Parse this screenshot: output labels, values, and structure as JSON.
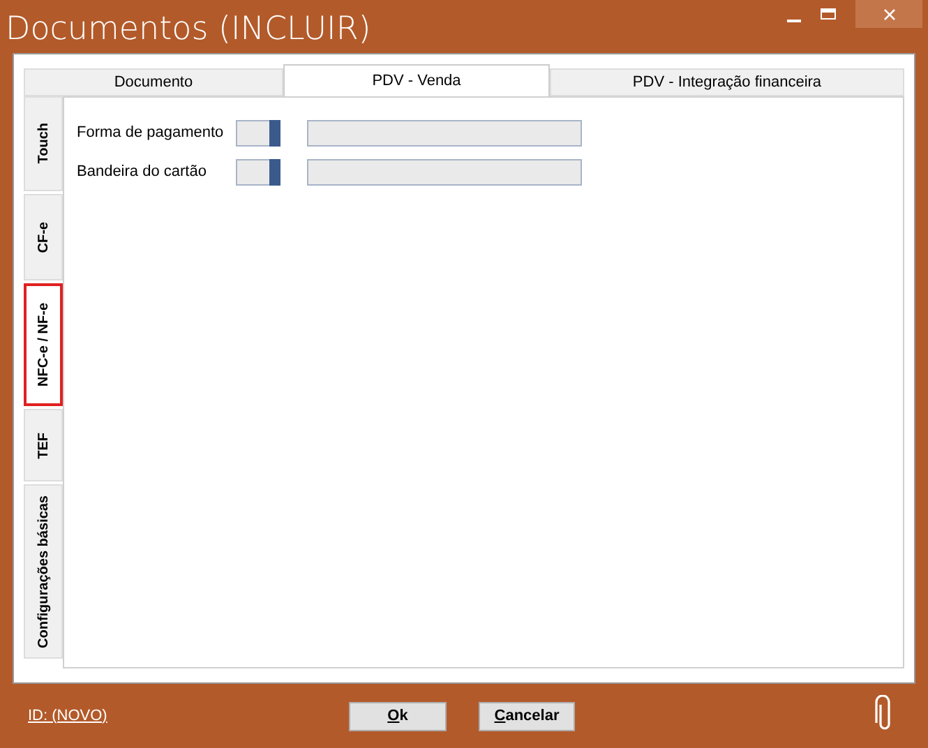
{
  "window": {
    "title": "Documentos (INCLUIR)"
  },
  "tabs": [
    {
      "label": "Documento",
      "selected": false
    },
    {
      "label": "PDV - Venda",
      "selected": true
    },
    {
      "label": "PDV - Integração financeira",
      "selected": false
    }
  ],
  "side_tabs": [
    {
      "label": "Touch",
      "selected": false
    },
    {
      "label": "CF-e",
      "selected": false
    },
    {
      "label": "NFC-e / NF-e",
      "selected": true
    },
    {
      "label": "TEF",
      "selected": false
    },
    {
      "label": "Configurações básicas",
      "selected": false
    }
  ],
  "fields": [
    {
      "label": "Forma de pagamento"
    },
    {
      "label": "Bandeira  do cartão"
    }
  ],
  "footer": {
    "id_link": "ID: (NOVO)",
    "buttons": [
      "Ok",
      "Cancelar"
    ]
  }
}
